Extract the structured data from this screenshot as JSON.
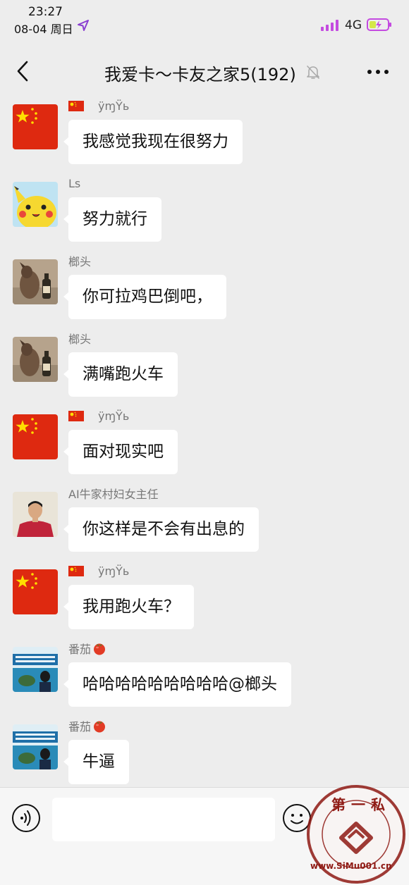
{
  "status_bar": {
    "time": "23:27",
    "date": "08-04 周日",
    "network": "4G",
    "icons": [
      "location-arrow-icon",
      "signal-icon",
      "battery-charging-icon"
    ]
  },
  "header": {
    "title": "我爱卡～卡友之家5(192)",
    "icons": [
      "back-icon",
      "mute-bell-icon",
      "more-icon"
    ]
  },
  "messages": [
    {
      "sender": "ÿɱŸь",
      "sender_prefix_icon": "china-flag-icon",
      "avatar": "china-flag",
      "text": "我感觉我现在很努力"
    },
    {
      "sender": "Ls",
      "avatar": "pikachu",
      "text": "努力就行"
    },
    {
      "sender": "榔头",
      "avatar": "dog-bottle",
      "text": "你可拉鸡巴倒吧，"
    },
    {
      "sender": "榔头",
      "avatar": "dog-bottle",
      "text": "满嘴跑火车"
    },
    {
      "sender": "ÿɱŸь",
      "sender_prefix_icon": "china-flag-icon",
      "avatar": "china-flag",
      "text": "面对现实吧"
    },
    {
      "sender": "AI牛家村妇女主任",
      "avatar": "man-red-shirt",
      "text": "你这样是不会有出息的"
    },
    {
      "sender": "ÿɱŸь",
      "sender_prefix_icon": "china-flag-icon",
      "avatar": "china-flag",
      "text": "我用跑火车？"
    },
    {
      "sender": "番茄",
      "sender_suffix_icon": "tomato-icon",
      "avatar": "turtle-poster",
      "text": "哈哈哈哈哈哈哈哈哈@榔头"
    },
    {
      "sender": "番茄",
      "sender_suffix_icon": "tomato-icon",
      "avatar": "turtle-poster",
      "text": "牛逼"
    }
  ],
  "input_bar": {
    "value": "",
    "icons": [
      "voice-icon",
      "emoji-icon"
    ]
  },
  "watermark": {
    "main": "第一私",
    "url": "www.SiMu001.cn"
  },
  "colors": {
    "background": "#ededed",
    "bubble": "#ffffff",
    "sender_text": "#777777"
  }
}
